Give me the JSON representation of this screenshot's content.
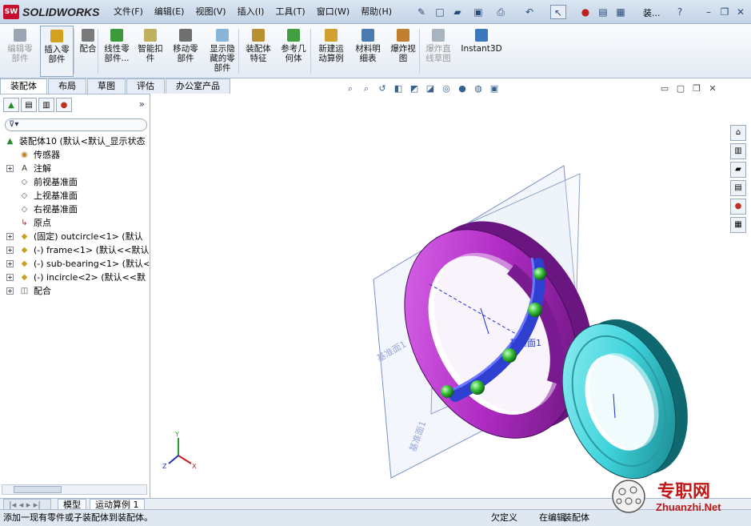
{
  "app": {
    "logo_badge": "SW",
    "logo_text": "SOLIDWORKS",
    "doc_title": "装..."
  },
  "menu": [
    "文件(F)",
    "编辑(E)",
    "视图(V)",
    "插入(I)",
    "工具(T)",
    "窗口(W)",
    "帮助(H)"
  ],
  "commands": [
    {
      "l1": "编辑零",
      "l2": "部件",
      "l3": "",
      "disabled": true,
      "color": "#9aa6b4"
    },
    {
      "l1": "插入零",
      "l2": "部件",
      "l3": "",
      "disabled": false,
      "color": "#d4a020",
      "sel": true
    },
    {
      "l1": "配合",
      "l2": "",
      "l3": "",
      "disabled": false,
      "color": "#7a7a7a"
    },
    {
      "l1": "线性零",
      "l2": "部件...",
      "l3": "",
      "disabled": false,
      "color": "#3c9a3c"
    },
    {
      "l1": "智能扣",
      "l2": "件",
      "l3": "",
      "disabled": false,
      "color": "#c0b060"
    },
    {
      "l1": "移动零",
      "l2": "部件",
      "l3": "",
      "disabled": false,
      "color": "#707070"
    },
    {
      "l1": "显示隐",
      "l2": "藏的零",
      "l3": "部件",
      "disabled": false,
      "color": "#8ab4d8"
    },
    {
      "l1": "装配体",
      "l2": "特征",
      "l3": "",
      "disabled": false,
      "color": "#b89030"
    },
    {
      "l1": "参考几",
      "l2": "何体",
      "l3": "",
      "disabled": false,
      "color": "#40a040"
    },
    {
      "l1": "新建运",
      "l2": "动算例",
      "l3": "",
      "disabled": false,
      "color": "#d0a030"
    },
    {
      "l1": "材料明",
      "l2": "细表",
      "l3": "",
      "disabled": false,
      "color": "#4a7ab0"
    },
    {
      "l1": "爆炸视",
      "l2": "图",
      "l3": "",
      "disabled": false,
      "color": "#c08030"
    },
    {
      "l1": "爆炸直",
      "l2": "线草图",
      "l3": "",
      "disabled": true,
      "color": "#a8b4c0"
    },
    {
      "l1": "Instant3D",
      "l2": "",
      "l3": "",
      "disabled": false,
      "color": "#3a78c0"
    }
  ],
  "tabs": [
    "装配体",
    "布局",
    "草图",
    "评估",
    "办公室产品"
  ],
  "tree": [
    {
      "label": "装配体10  (默认<默认_显示状态",
      "icon": "asm",
      "exp": "",
      "indent": 0
    },
    {
      "label": "传感器",
      "icon": "sensor",
      "exp": "",
      "indent": 1
    },
    {
      "label": "注解",
      "icon": "A",
      "exp": "+",
      "indent": 1
    },
    {
      "label": "前视基准面",
      "icon": "plane",
      "exp": "",
      "indent": 1
    },
    {
      "label": "上视基准面",
      "icon": "plane",
      "exp": "",
      "indent": 1
    },
    {
      "label": "右视基准面",
      "icon": "plane",
      "exp": "",
      "indent": 1
    },
    {
      "label": "原点",
      "icon": "origin",
      "exp": "",
      "indent": 1
    },
    {
      "label": "(固定) outcircle<1> (默认",
      "icon": "part",
      "exp": "+",
      "indent": 1
    },
    {
      "label": "(-) frame<1> (默认<<默认>",
      "icon": "part",
      "exp": "+",
      "indent": 1
    },
    {
      "label": "(-) sub-bearing<1> (默认<",
      "icon": "part",
      "exp": "+",
      "indent": 1
    },
    {
      "label": "(-) incircle<2> (默认<<默",
      "icon": "part",
      "exp": "+",
      "indent": 1
    },
    {
      "label": "配合",
      "icon": "mate",
      "exp": "+",
      "indent": 1
    }
  ],
  "bottom_tabs": [
    "模型",
    "运动算例 1"
  ],
  "status": {
    "message": "添加一现有零件或子装配体到装配体。",
    "s1": "欠定义",
    "s2": "在编辑",
    "s3": "装配体"
  },
  "viewport": {
    "plane1": "基准面1",
    "plane_label": "基准面1",
    "plane2": "基准面1"
  },
  "watermark": {
    "cn": "专职网",
    "en": "Zhuanzhi.Net"
  },
  "colors": {
    "outer_ring": "#b02cc4",
    "inner_ring": "#3fd4dc",
    "cage": "#2f3fd0",
    "balls": "#38c03a"
  }
}
